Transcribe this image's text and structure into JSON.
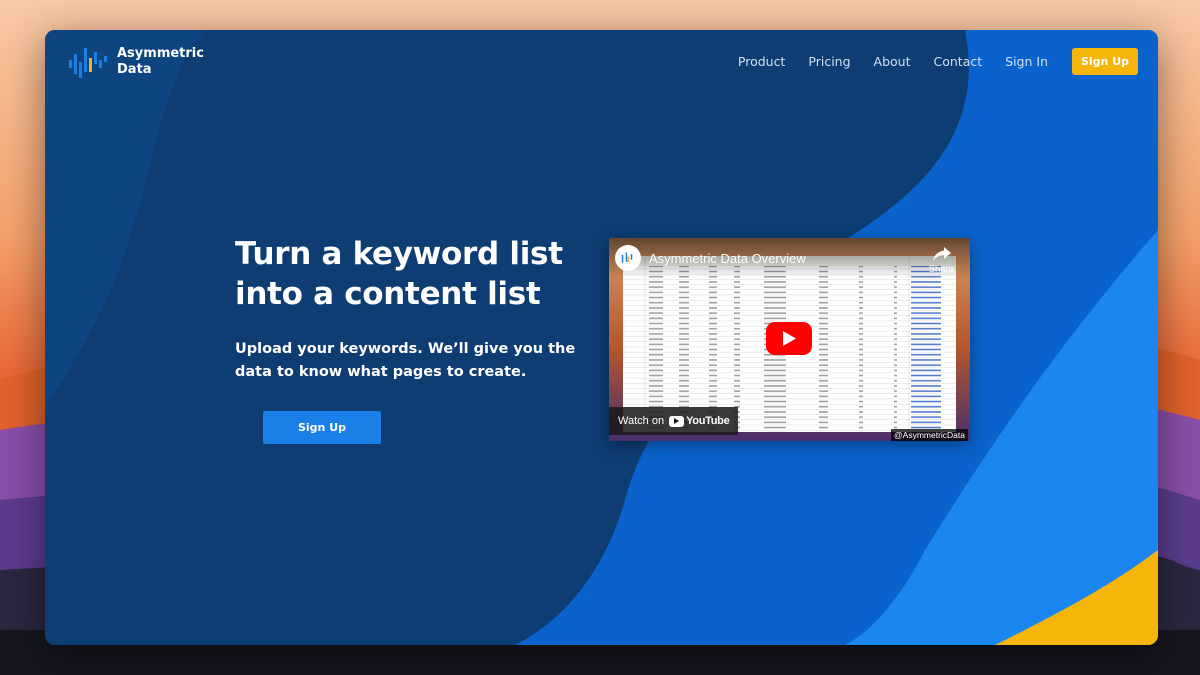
{
  "brand": {
    "name_line1": "Asymmetric",
    "name_line2": "Data",
    "logo_icon": "waveform-bars-icon"
  },
  "nav": {
    "items": [
      "Product",
      "Pricing",
      "About",
      "Contact",
      "Sign In"
    ],
    "cta_label": "Sign Up"
  },
  "hero": {
    "title": "Turn a keyword list into a content list",
    "subtitle": "Upload your keywords. We’ll give you the data to know what pages to create.",
    "cta_label": "Sign Up"
  },
  "video": {
    "title": "Asymmetric Data Overview",
    "share_label": "Share",
    "watch_on_label": "Watch on",
    "platform": "YouTube",
    "channel_handle": "@AsymmetricData",
    "play_icon": "play-icon",
    "share_icon": "share-arrow-icon"
  },
  "colors": {
    "primary_dark": "#0d3d73",
    "primary_blue": "#1a7fe6",
    "accent_yellow": "#f5b50a",
    "youtube_red": "#ff0000"
  }
}
